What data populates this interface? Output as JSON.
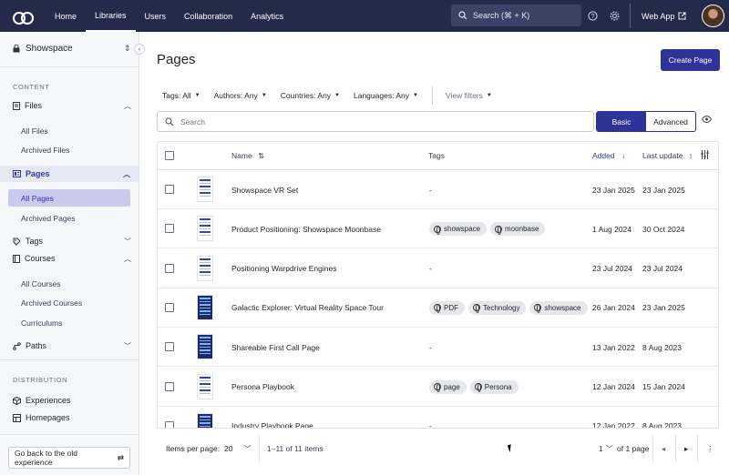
{
  "topnav": {
    "links": [
      {
        "label": "Home",
        "active": false
      },
      {
        "label": "Libraries",
        "active": true
      },
      {
        "label": "Users",
        "active": false
      },
      {
        "label": "Collaboration",
        "active": false
      },
      {
        "label": "Analytics",
        "active": false
      }
    ],
    "search_label": "Search (⌘ + K)",
    "web_app_label": "Web App"
  },
  "sidebar": {
    "workspace": "Showspace",
    "content_title": "CONTENT",
    "files": {
      "label": "Files",
      "items": [
        "All Files",
        "Archived Files"
      ]
    },
    "pages": {
      "label": "Pages",
      "items": [
        "All Pages",
        "Archived Pages"
      ]
    },
    "tags": {
      "label": "Tags"
    },
    "courses": {
      "label": "Courses",
      "items": [
        "All Courses",
        "Archived Courses",
        "Curriculums"
      ]
    },
    "paths": {
      "label": "Paths"
    },
    "distribution_title": "DISTRIBUTION",
    "experiences": "Experiences",
    "homepages": "Homepages",
    "old_experience": "Go back to the old experience"
  },
  "main": {
    "title": "Pages",
    "create_button": "Create Page",
    "filters": [
      {
        "label": "Tags: All"
      },
      {
        "label": "Authors: Any"
      },
      {
        "label": "Countries: Any"
      },
      {
        "label": "Languages: Any"
      }
    ],
    "view_filters": "View filters",
    "search_placeholder": "Search",
    "mode_basic": "Basic",
    "mode_advanced": "Advanced"
  },
  "table": {
    "columns": {
      "name": "Name",
      "tags": "Tags",
      "added": "Added",
      "last_update": "Last update"
    },
    "rows": [
      {
        "name": "Showspace VR Set",
        "tags": [],
        "no_tags": "-",
        "added": "23 Jan 2025",
        "last_update": "23 Jan 2025",
        "thumb": "light"
      },
      {
        "name": "Product Positioning: Showspace Moonbase",
        "tags": [
          "showspace",
          "moonbase"
        ],
        "no_tags": "",
        "added": "1 Aug 2024",
        "last_update": "30 Oct 2024",
        "thumb": "light"
      },
      {
        "name": "Positioning Warpdrive Engines",
        "tags": [],
        "no_tags": "-",
        "added": "23 Jul 2024",
        "last_update": "23 Jul 2024",
        "thumb": "light"
      },
      {
        "name": "Galactic Explorer: Virtual Reality Space Tour",
        "tags": [
          "PDF",
          "Technology",
          "showspace"
        ],
        "no_tags": "",
        "added": "26 Jan 2024",
        "last_update": "23 Jan 2025",
        "thumb": "dark"
      },
      {
        "name": "Shareable First Call Page",
        "tags": [],
        "no_tags": "-",
        "added": "13 Jan 2022",
        "last_update": "8 Aug 2023",
        "thumb": "dark"
      },
      {
        "name": "Persona Playbook",
        "tags": [
          "page",
          "Persona"
        ],
        "no_tags": "",
        "added": "12 Jan 2024",
        "last_update": "15 Jan 2024",
        "thumb": "light"
      },
      {
        "name": "Industry Playbook Page",
        "tags": [],
        "no_tags": "-",
        "added": "12 Jan 2022",
        "last_update": "8 Aug 2023",
        "thumb": "dark"
      }
    ]
  },
  "footer": {
    "items_per_page_label": "Items per page:",
    "items_per_page_value": "20",
    "range_text": "1–11 of 11 items",
    "page_value": "1",
    "page_of_text": "of 1 page"
  }
}
